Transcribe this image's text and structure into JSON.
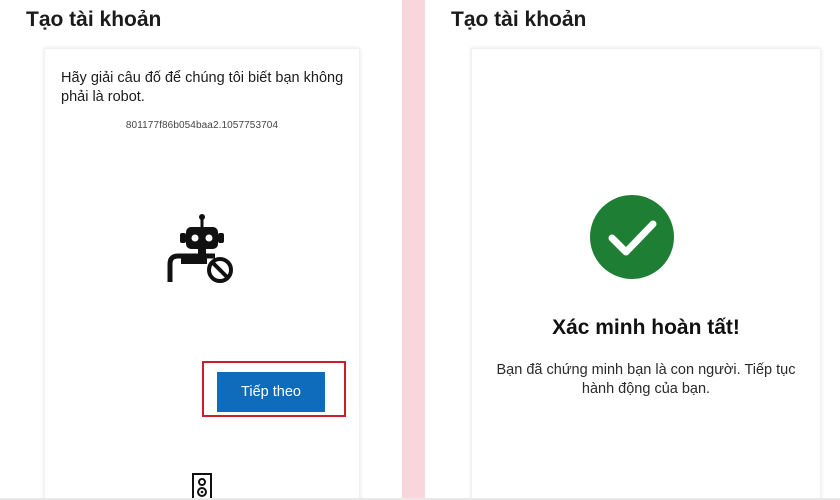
{
  "left_panel": {
    "title": "Tạo tài khoản",
    "instruction": "Hãy giải câu đố để chúng tôi biết bạn không phải là robot.",
    "session_id": "801177f86b054baa2.1057753704",
    "robot_icon": "robot-blocked-icon",
    "next_button_label": "Tiếp theo",
    "audio_icon": "speaker-icon"
  },
  "right_panel": {
    "title": "Tạo tài khoản",
    "check_icon": "check-circle-icon",
    "verify_title": "Xác minh hoàn tất!",
    "verify_text": "Bạn đã chứng minh bạn là con người. Tiếp tục hành động của bạn."
  },
  "colors": {
    "primary_button": "#0f6cbd",
    "success": "#1e7e34",
    "highlight_border": "#c7202a",
    "divider": "#f8d6dc"
  }
}
